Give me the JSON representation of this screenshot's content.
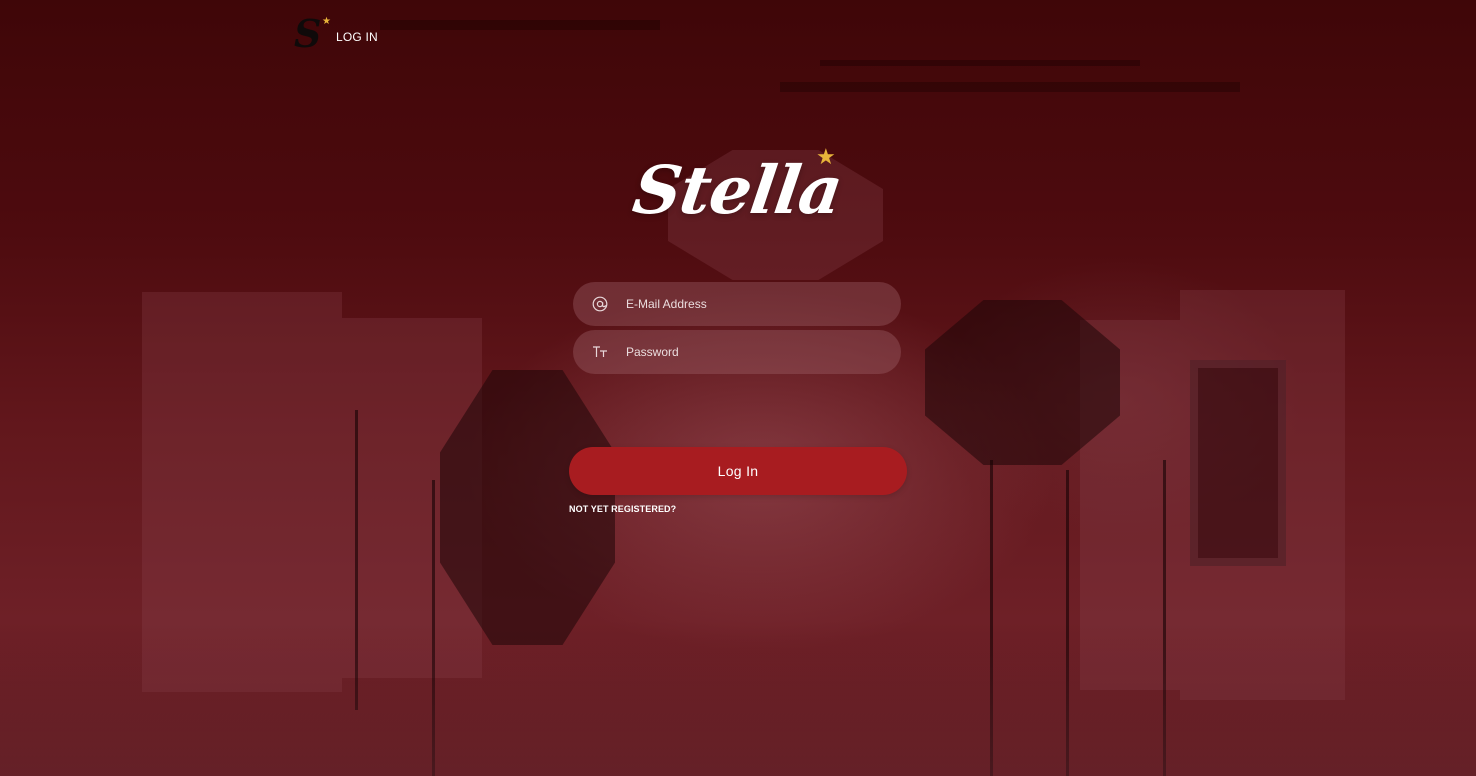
{
  "header": {
    "logo_letter": "S",
    "nav_login_label": "LOG IN"
  },
  "brand": {
    "wordmark": "Stella"
  },
  "form": {
    "email": {
      "placeholder": "E-Mail Address",
      "value": "",
      "icon": "at-sign-icon"
    },
    "password": {
      "placeholder": "Password",
      "value": "",
      "icon": "text-size-icon"
    },
    "submit_label": "Log In",
    "register_label": "NOT YET REGISTERED?"
  },
  "colors": {
    "accent": "#a81c20",
    "star": "#e8b43a",
    "background": "#5a0f14"
  }
}
